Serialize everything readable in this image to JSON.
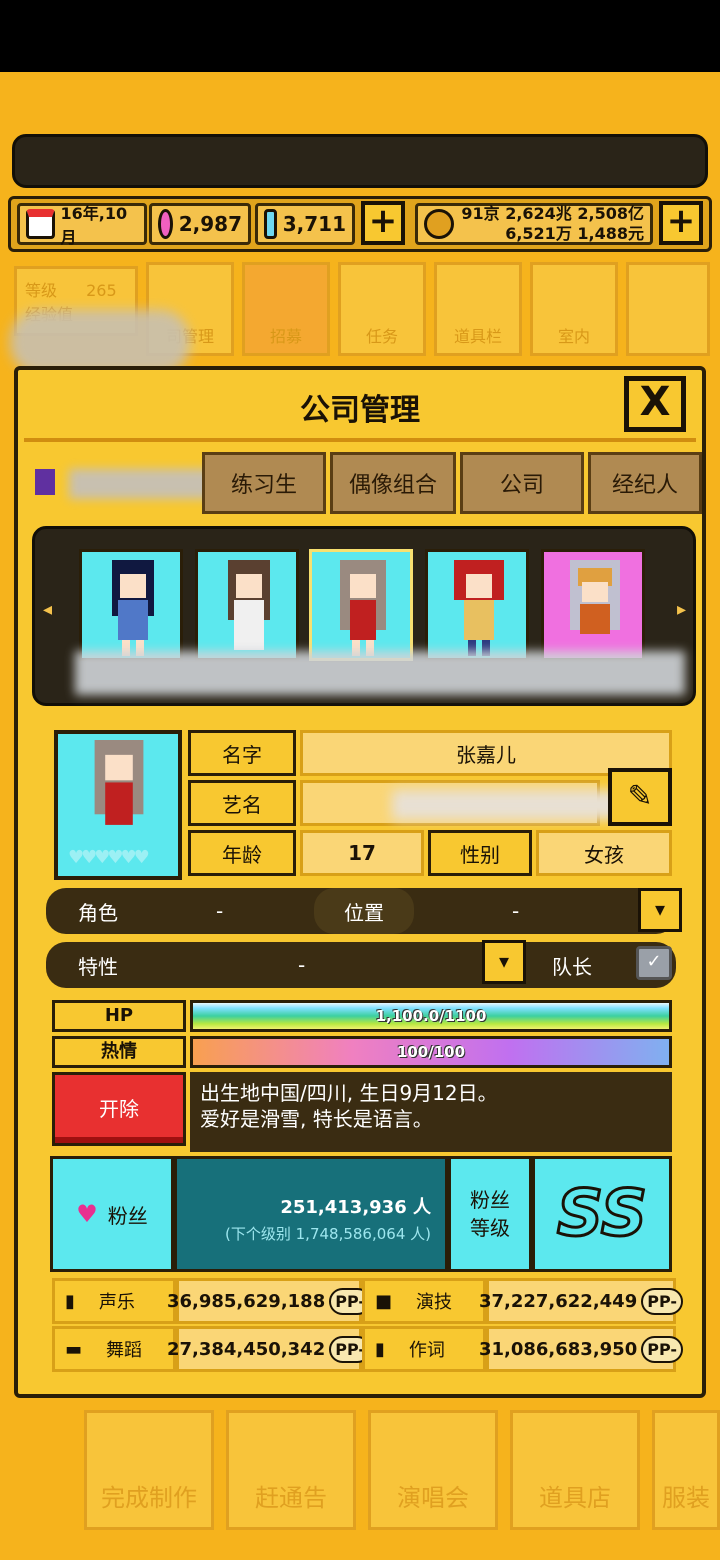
{
  "resources": {
    "date": "16年,10月",
    "gems_pink": "2,987",
    "gems_blue": "3,711",
    "money_line1": "91京 2,624兆 2,508亿",
    "money_line2": "6,521万 1,488元"
  },
  "bg_menu": {
    "level_label": "等级",
    "level_value": "265",
    "exp_label": "经验值",
    "items": [
      "司管理",
      "招募",
      "任务",
      "道具栏",
      "室内"
    ]
  },
  "panel": {
    "title": "公司管理",
    "close": "X",
    "tabs": [
      "练习生",
      "偶像组合",
      "公司",
      "经纪人"
    ]
  },
  "profile": {
    "name_label": "名字",
    "name_value": "张嘉儿",
    "stage_label": "艺名",
    "stage_value": "",
    "age_label": "年龄",
    "age_value": "17",
    "gender_label": "性别",
    "gender_value": "女孩",
    "role_label": "角色",
    "role_value": "-",
    "position_label": "位置",
    "position_value": "-",
    "trait_label": "特性",
    "trait_value": "-",
    "leader_label": "队长"
  },
  "bars": {
    "hp_label": "HP",
    "hp_text": "1,100.0/1100",
    "hp_fraction": 1.0,
    "passion_label": "热情",
    "passion_text": "100/100",
    "passion_fraction": 1.0
  },
  "bio": {
    "fire_button": "开除",
    "line1": "出生地中国/四川, 生日9月12日。",
    "line2": "爱好是滑雪, 特长是语言。"
  },
  "fans": {
    "label": "粉丝",
    "count": "251,413,936 人",
    "next": "(下个级别 1,748,586,064 人)",
    "level_label_1": "粉丝",
    "level_label_2": "等级",
    "rank": "SS"
  },
  "stats": [
    {
      "name": "声乐",
      "value": "36,985,629,188",
      "pp": "PP-"
    },
    {
      "name": "演技",
      "value": "37,227,622,449",
      "pp": "PP-"
    },
    {
      "name": "舞蹈",
      "value": "27,384,450,342",
      "pp": "PP-"
    },
    {
      "name": "作词",
      "value": "31,086,683,950",
      "pp": "PP-"
    }
  ],
  "bottom_nav": [
    "完成制作",
    "赶通告",
    "演唱会",
    "道具店",
    "服装"
  ],
  "colors": {
    "background": "#f6b31c",
    "panel": "#f8c830",
    "dark": "#3a2c12",
    "cyan": "#5ce8ee",
    "fire_red": "#e83030"
  }
}
